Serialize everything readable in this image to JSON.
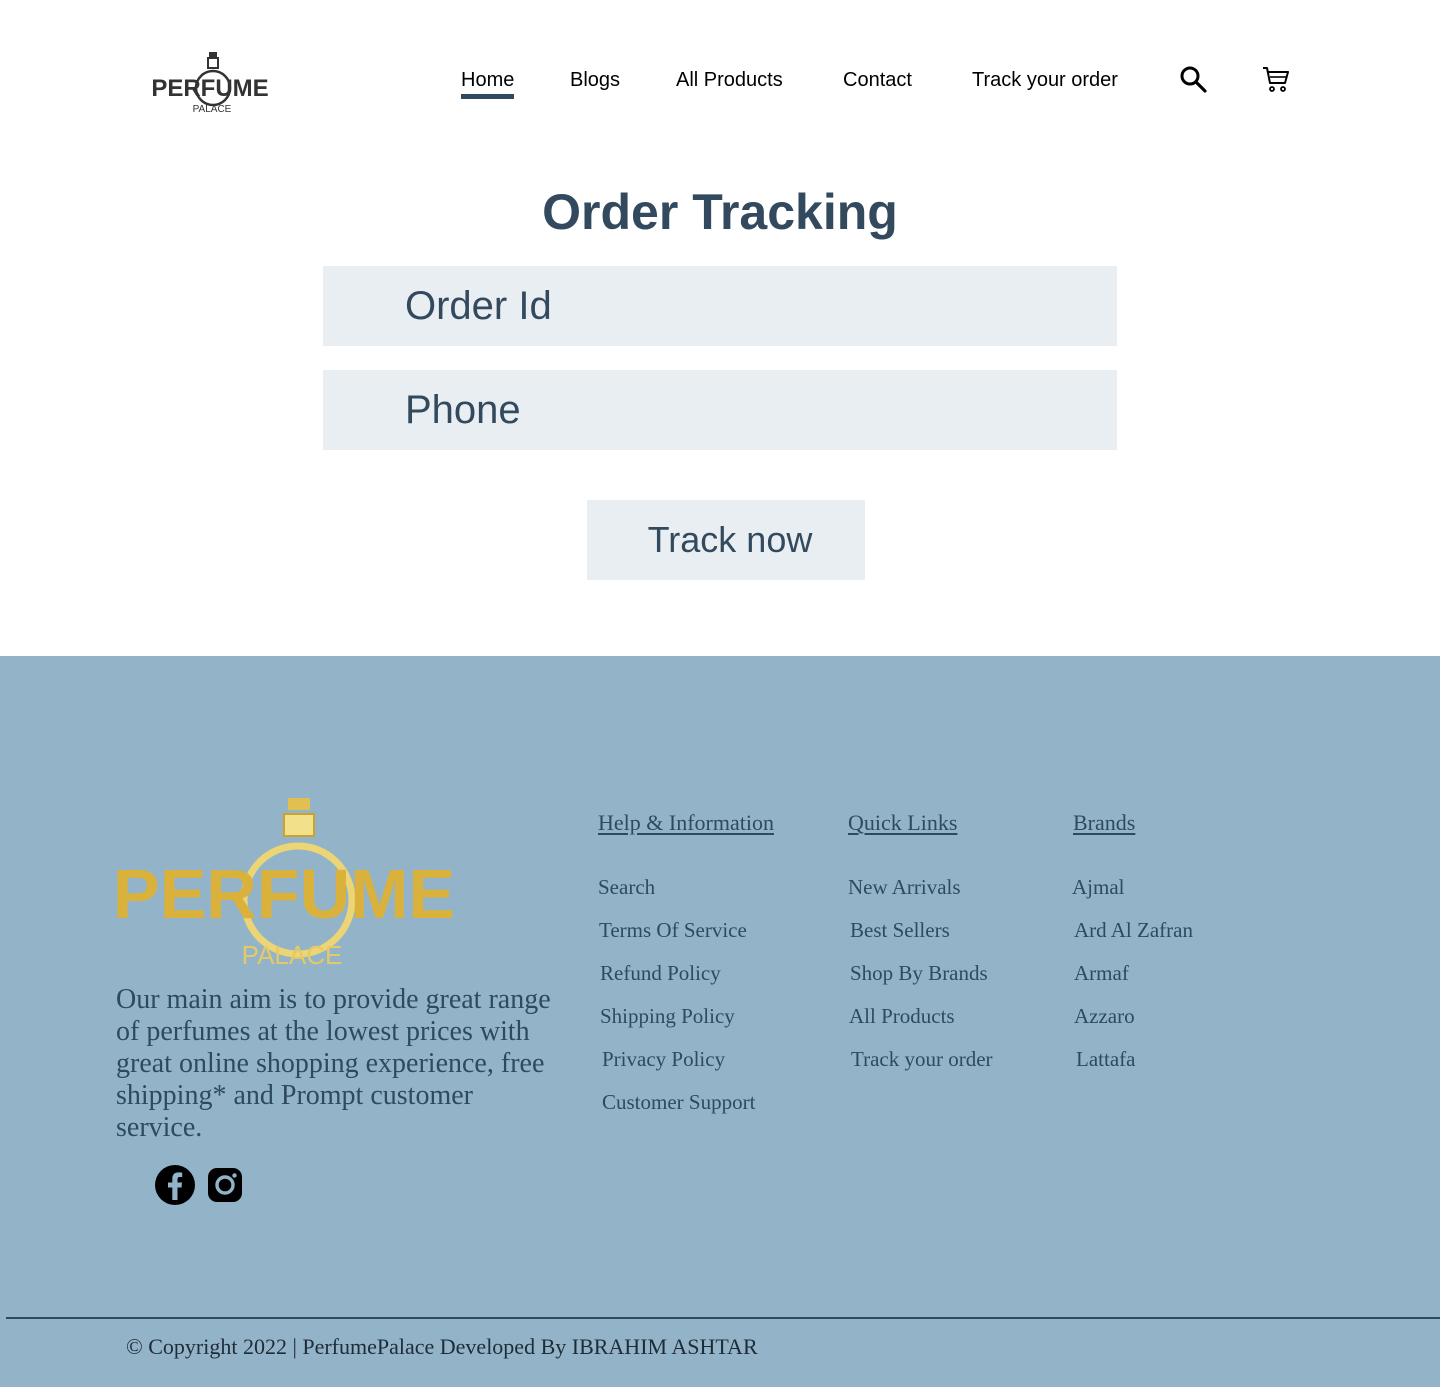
{
  "brand": {
    "line1": "PERFUME",
    "line2": "PALACE"
  },
  "nav": {
    "items": [
      {
        "label": "Home",
        "active": true
      },
      {
        "label": "Blogs"
      },
      {
        "label": "All Products"
      },
      {
        "label": "Contact"
      },
      {
        "label": "Track your order"
      }
    ],
    "search_icon": "search-icon",
    "cart_icon": "cart-icon"
  },
  "tracking": {
    "title": "Order Tracking",
    "order_id_placeholder": "Order Id",
    "order_id_value": "",
    "phone_placeholder": "Phone",
    "phone_value": "",
    "button_label": "Track now"
  },
  "footer": {
    "about": "Our main aim is to provide great range of perfumes at the lowest prices with great online shopping experience, free shipping* and Prompt customer service.",
    "social": [
      "facebook-icon",
      "instagram-icon"
    ],
    "columns": [
      {
        "heading": "Help & Information",
        "links": [
          "Search",
          "Terms Of Service",
          "Refund Policy",
          "Shipping Policy",
          "Privacy Policy",
          "Customer Support"
        ]
      },
      {
        "heading": "Quick Links",
        "links": [
          "New Arrivals",
          "Best Sellers",
          "Shop By Brands",
          "All Products",
          "Track your order"
        ]
      },
      {
        "heading": "Brands",
        "links": [
          "Ajmal",
          "Ard Al Zafran",
          "Armaf",
          "Azzaro",
          "Lattafa"
        ]
      }
    ],
    "copyright": "© Copyright 2022 | PerfumePalace Developed By IBRAHIM ASHTAR"
  },
  "colors": {
    "accent": "#334a5e",
    "field_bg": "#e9eef3",
    "footer_bg": "#93b4c8",
    "gold": "#d9b13b"
  }
}
